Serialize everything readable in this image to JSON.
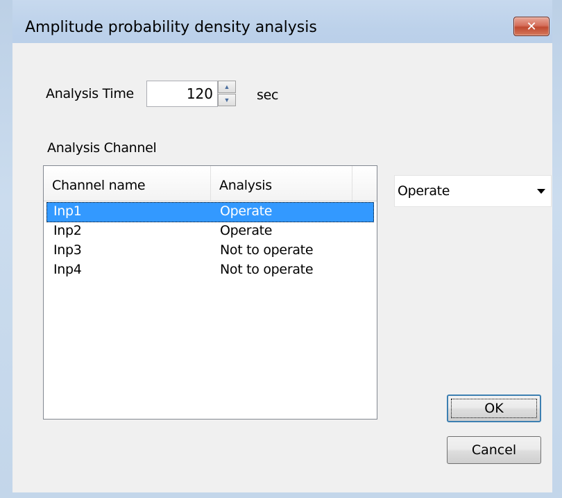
{
  "window": {
    "title": "Amplitude probability density analysis",
    "close_glyph": "✕"
  },
  "analysis_time": {
    "label": "Analysis Time",
    "value": "120",
    "unit": "sec"
  },
  "channel_section": {
    "label": "Analysis Channel"
  },
  "table": {
    "columns": [
      "Channel name",
      "Analysis"
    ],
    "rows": [
      {
        "channel": "Inp1",
        "analysis": "Operate",
        "selected": true
      },
      {
        "channel": "Inp2",
        "analysis": "Operate",
        "selected": false
      },
      {
        "channel": "Inp3",
        "analysis": "Not to operate",
        "selected": false
      },
      {
        "channel": "Inp4",
        "analysis": "Not to operate",
        "selected": false
      }
    ]
  },
  "analysis_select": {
    "value": "Operate"
  },
  "buttons": {
    "ok": "OK",
    "cancel": "Cancel"
  },
  "colors": {
    "selection": "#3399ff",
    "close_button": "#c04a31",
    "titlebar": "#bcd1ea"
  },
  "icons": {
    "close": "close-icon",
    "spin_up": "chevron-up-icon",
    "spin_down": "chevron-down-icon",
    "combo": "chevron-down-icon"
  }
}
